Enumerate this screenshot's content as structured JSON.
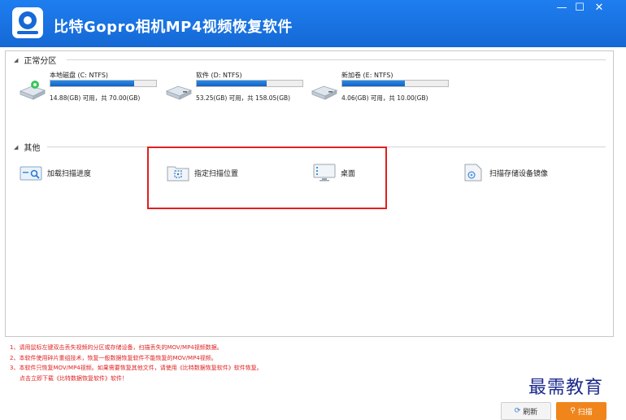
{
  "window": {
    "title": "比特Gopro相机MP4视频恢复软件",
    "controls": {
      "minimize": "—",
      "maximize": "☐",
      "close": "✕"
    }
  },
  "sections": {
    "partitions_label": "正常分区",
    "other_label": "其他"
  },
  "drives": [
    {
      "name": "本地磁盘 (C: NTFS)",
      "usage": "14.88(GB) 可用，共 70.00(GB)",
      "fill_fraction": 0.79
    },
    {
      "name": "软件 (D: NTFS)",
      "usage": "53.25(GB) 可用，共 158.05(GB)",
      "fill_fraction": 0.66
    },
    {
      "name": "新加卷 (E: NTFS)",
      "usage": "4.06(GB) 可用，共 10.00(GB)",
      "fill_fraction": 0.59
    }
  ],
  "other_items": [
    {
      "label": "加载扫描进度",
      "icon": "scan-progress-icon"
    },
    {
      "label": "指定扫描位置",
      "icon": "folder-target-icon"
    },
    {
      "label": "桌面",
      "icon": "desktop-icon"
    },
    {
      "label": "扫描存储设备镜像",
      "icon": "disk-image-icon"
    }
  ],
  "notes": [
    "1、请用鼠标左键双击丢失视频的分区或存储设备，扫描丢失的MOV/MP4视频数据。",
    "2、本软件使用碎片重组技术，恢复一般数据恢复软件不能恢复的MOV/MP4视频。",
    "3、本软件只恢复MOV/MP4视频。如果需要恢复其他文件，请使用《比特数据恢复软件》软件恢复。",
    "点击立即下载《比特数据恢复软件》软件！"
  ],
  "buttons": {
    "refresh": "刷新",
    "scan": "扫描"
  },
  "watermark": "最需教育",
  "colors": {
    "titlebar": "#1a74e4",
    "accent_orange": "#f0851c",
    "note_red": "#e02020",
    "highlight_red": "#e02020"
  }
}
